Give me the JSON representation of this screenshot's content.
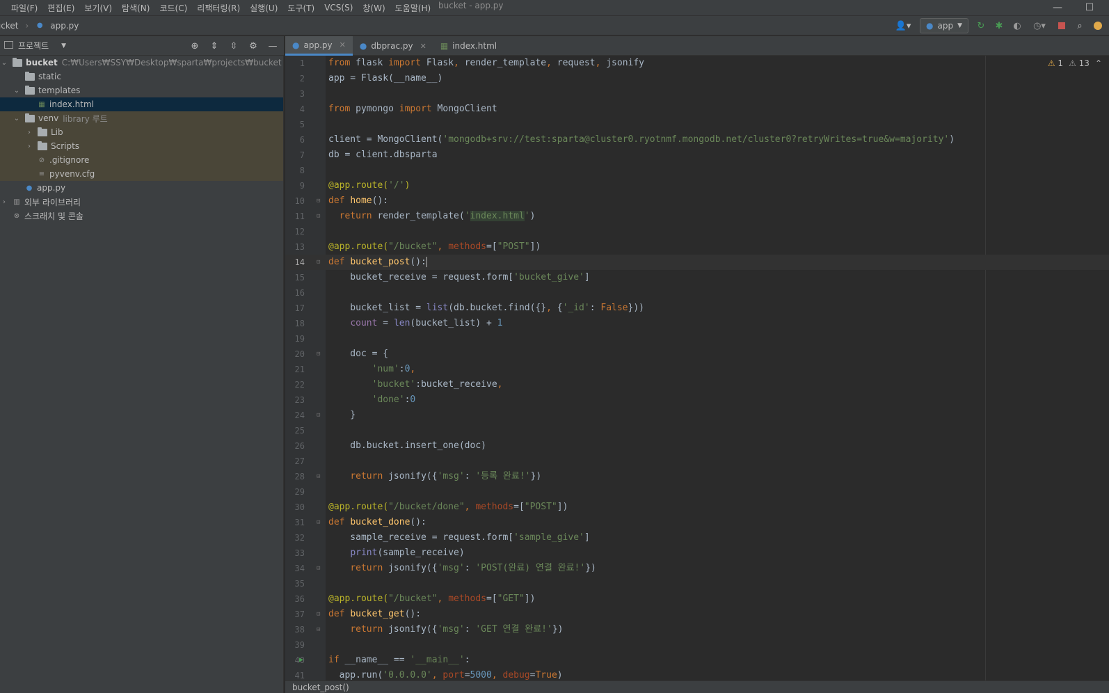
{
  "window": {
    "title": "bucket - app.py"
  },
  "menu": [
    "파일(F)",
    "편집(E)",
    "보기(V)",
    "탐색(N)",
    "코드(C)",
    "리팩터링(R)",
    "실행(U)",
    "도구(T)",
    "VCS(S)",
    "창(W)",
    "도움말(H)"
  ],
  "breadcrumb": {
    "root": "bucket",
    "file": "app.py"
  },
  "toolbar": {
    "run_config": "app"
  },
  "project": {
    "title": "프로젝트",
    "root": {
      "name": "bucket",
      "path": "C:₩Users₩SSY₩Desktop₩sparta₩projects₩bucket"
    },
    "items": [
      "static",
      "templates",
      "index.html",
      "venv",
      "Lib",
      "Scripts",
      ".gitignore",
      "pyvenv.cfg",
      "app.py",
      "외부 라이브러리",
      "스크래치 및 콘솔"
    ],
    "venv_hint": "library 루트"
  },
  "tabs": [
    {
      "label": "app.py",
      "active": true
    },
    {
      "label": "dbprac.py",
      "active": false
    },
    {
      "label": "index.html",
      "active": false
    }
  ],
  "inspections": {
    "warnings": "1",
    "weak_warnings": "13"
  },
  "editor": {
    "current_line": 14
  },
  "status": {
    "context": "bucket_post()"
  }
}
